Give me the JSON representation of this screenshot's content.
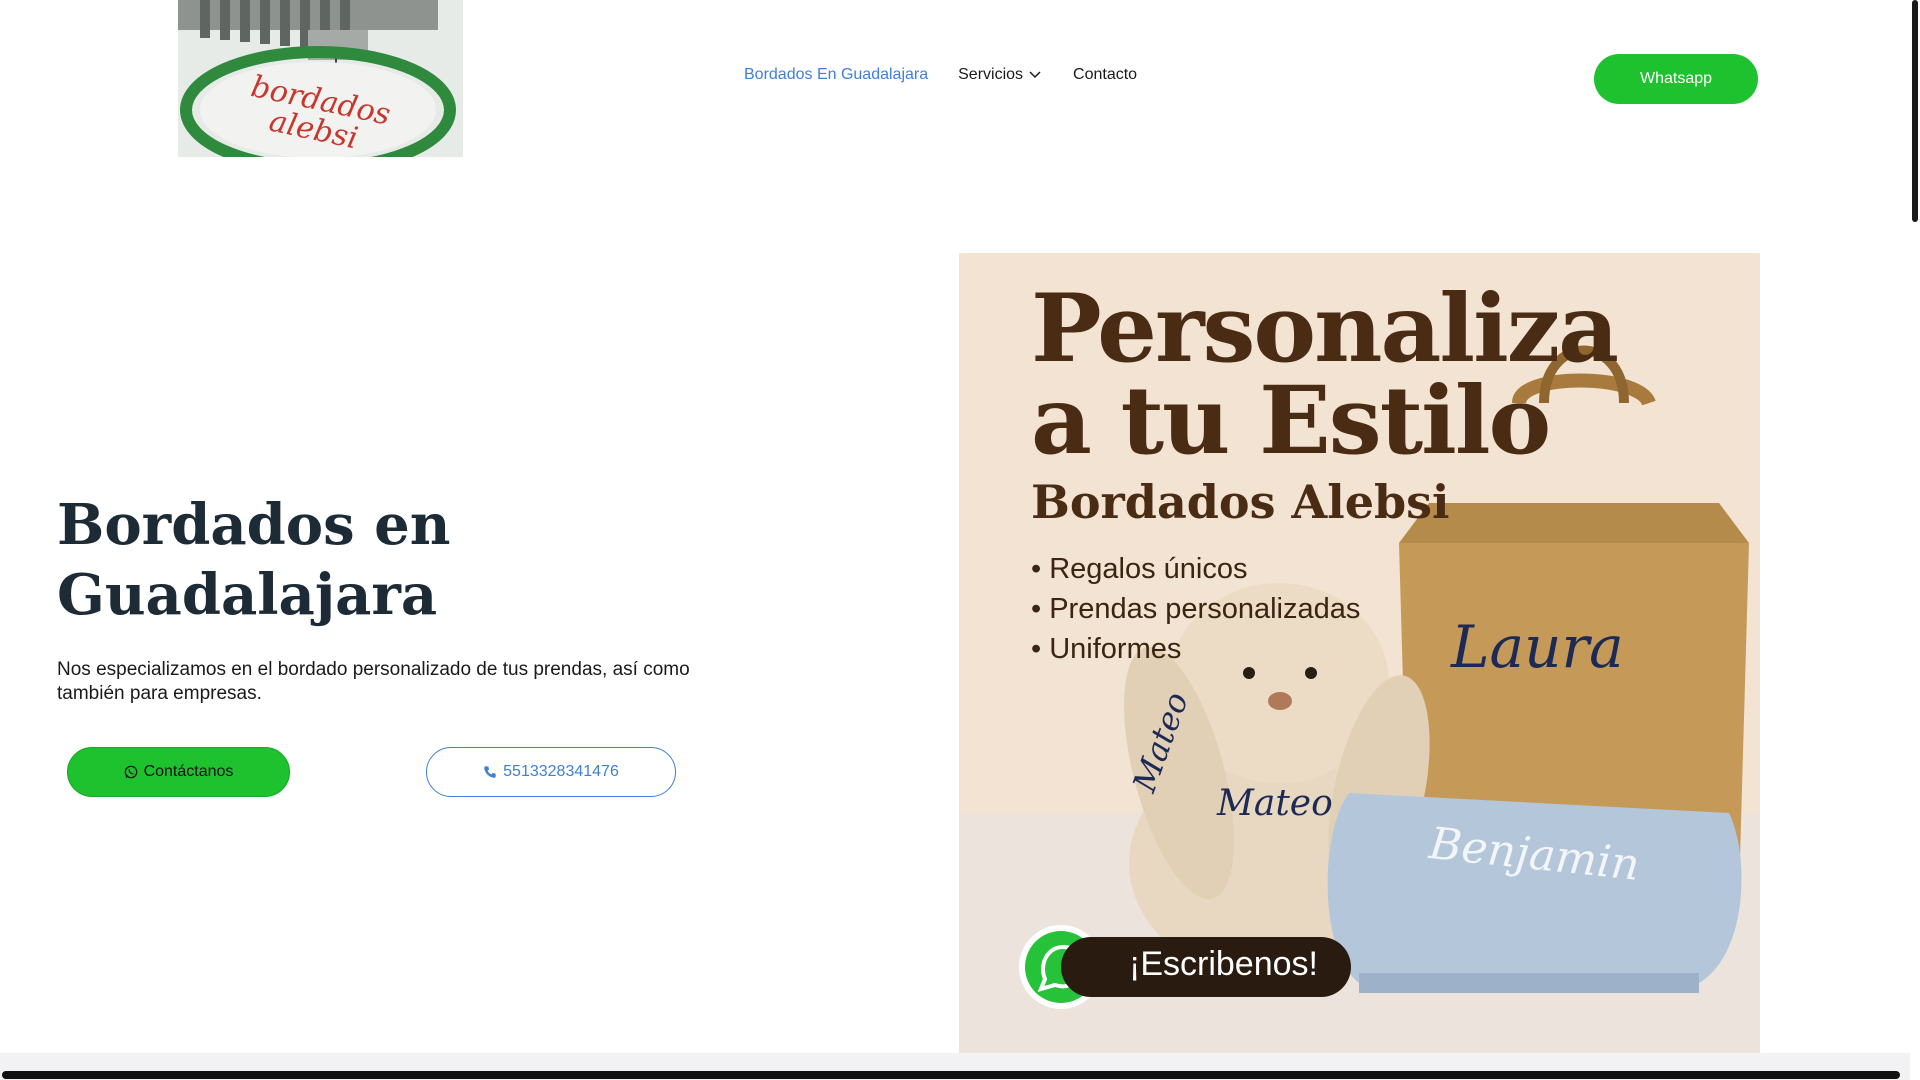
{
  "nav": {
    "home_label": "Bordados En Guadalajara",
    "services_label": "Servicios",
    "contact_label": "Contacto",
    "whatsapp_label": "Whatsapp"
  },
  "logo": {
    "text_line1": "bordados",
    "text_line2": "alebsi"
  },
  "hero": {
    "title_line1": "Bordados en",
    "title_line2": "Guadalajara",
    "description": " Nos especializamos en el bordado personalizado de tus prendas, así como también para empresas.",
    "contact_button": "Contáctanos",
    "phone_button": "5513328341476"
  },
  "promo": {
    "headline_line1": "Personaliza",
    "headline_line2": "a tu Estilo",
    "brand": "Bordados Alebsi",
    "bullets": [
      "Regalos únicos",
      "Prendas personalizadas",
      "Uniformes"
    ],
    "name_bag": "Laura",
    "name_ear": "Mateo",
    "name_bunny": "Mateo",
    "name_blanket": "Benjamin",
    "cta": "¡Escribenos!"
  },
  "colors": {
    "accent_green": "#1ec22f",
    "link_blue": "#3f7fd6",
    "heading_dark": "#1d2b36",
    "promo_brown": "#4a2c14"
  }
}
